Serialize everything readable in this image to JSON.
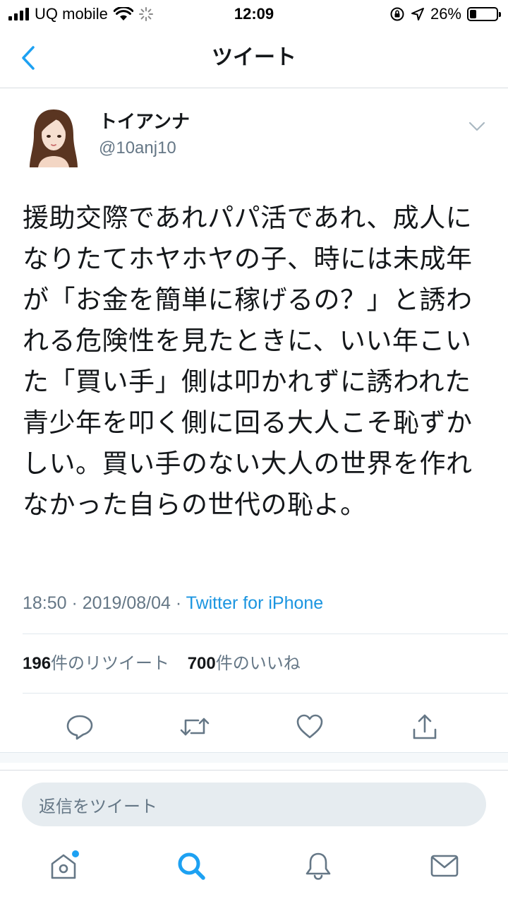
{
  "status_bar": {
    "carrier": "UQ mobile",
    "time": "12:09",
    "battery_percent": "26%",
    "battery_level": 0.26,
    "icons": [
      "signal-icon",
      "wifi-icon",
      "loading-icon",
      "orientation-lock-icon",
      "location-icon",
      "battery-icon"
    ]
  },
  "header": {
    "back_icon": "chevron-left-icon",
    "title": "ツイート"
  },
  "tweet": {
    "author": {
      "name": "トイアンナ",
      "handle": "@10anj10"
    },
    "text": "援助交際であれパパ活であれ、成人になりたてホヤホヤの子、時には未成年が「お金を簡単に稼げるの？」と誘われる危険性を見たときに、いい年こいた「買い手」側は叩かれずに誘われた青少年を叩く側に回る大人こそ恥ずかしい。買い手のない大人の世界を作れなかった自らの世代の恥よ。",
    "timestamp": "18:50 · 2019/08/04 · ",
    "source": "Twitter for iPhone",
    "retweets": {
      "count": "196",
      "label": "件のリツイート"
    },
    "likes": {
      "count": "700",
      "label": "件のいいね"
    },
    "actions": [
      "reply-icon",
      "retweet-icon",
      "like-icon",
      "share-icon"
    ]
  },
  "reply_bar": {
    "placeholder": "返信をツイート"
  },
  "tab_bar": {
    "tabs": [
      "home-icon",
      "search-icon",
      "notifications-icon",
      "messages-icon"
    ],
    "active": "search-icon"
  },
  "colors": {
    "accent": "#1da1f2",
    "link": "#1b95e0",
    "secondary_text": "#657786",
    "text": "#14171a",
    "reply_field": "#e6ecf0"
  }
}
